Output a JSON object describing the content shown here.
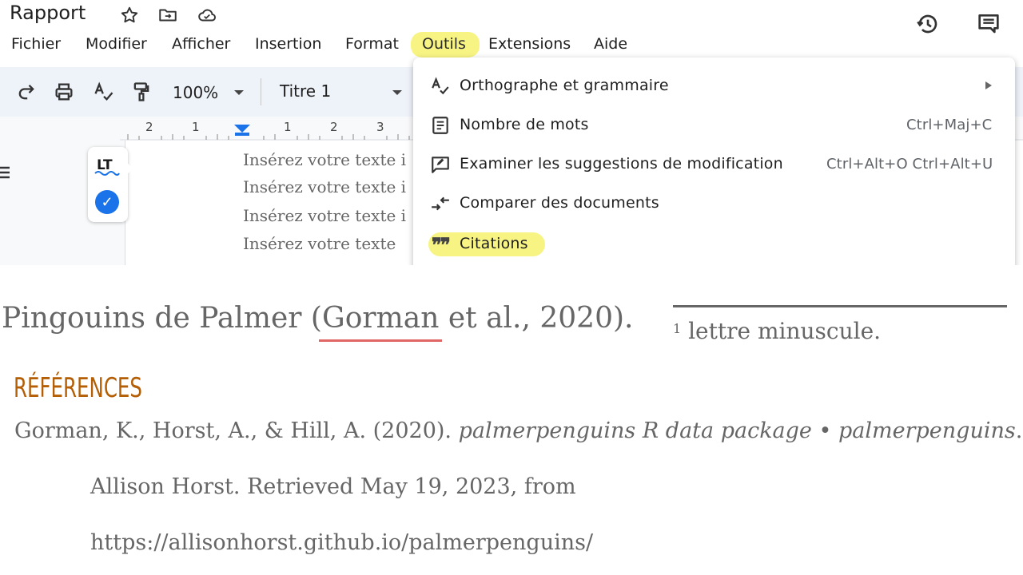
{
  "doc": {
    "title": "Rapport"
  },
  "menubar": {
    "items": [
      "Fichier",
      "Modifier",
      "Afficher",
      "Insertion",
      "Format",
      "Outils",
      "Extensions",
      "Aide"
    ]
  },
  "toolbar": {
    "zoom": "100%",
    "style": "Titre 1"
  },
  "ruler": {
    "labels": [
      "2",
      "1",
      "1",
      "2",
      "3"
    ]
  },
  "lt_widget": {
    "logo": "LT"
  },
  "doc_lines": [
    "Insérez votre texte i",
    "Insérez votre texte i",
    "Insérez votre texte i",
    "Insérez votre texte"
  ],
  "tools_menu": {
    "items": [
      {
        "label": "Orthographe et grammaire",
        "shortcut": "",
        "icon": "spellcheck-icon",
        "submenu": true
      },
      {
        "label": "Nombre de mots",
        "shortcut": "Ctrl+Maj+C",
        "icon": "word-count-icon"
      },
      {
        "label": "Examiner les suggestions de modification",
        "shortcut": "Ctrl+Alt+O Ctrl+Alt+U",
        "icon": "review-edits-icon"
      },
      {
        "label": "Comparer des documents",
        "shortcut": "",
        "icon": "compare-icon"
      },
      {
        "label": "Citations",
        "shortcut": "",
        "icon": "quote-icon"
      }
    ]
  },
  "highlight_color": "#f6f05a",
  "bottom": {
    "sentence_pre": "Pingouins de Palmer (",
    "sentence_word": "Gorman",
    "sentence_post": " et al., 2020).",
    "footnote_num": "1",
    "footnote_text": " lettre minuscule.",
    "refs_heading": "RÉFÉRENCES",
    "ref_line1_plain": "Gorman, K., Horst, A., & Hill, A. (2020). ",
    "ref_line1_italic": "palmerpenguins R data package • palmerpenguins",
    "ref_line1_end": ".",
    "ref_line2": "Allison Horst. Retrieved May 19, 2023, from",
    "ref_line3": "https://allisonhorst.github.io/palmerpenguins/"
  }
}
